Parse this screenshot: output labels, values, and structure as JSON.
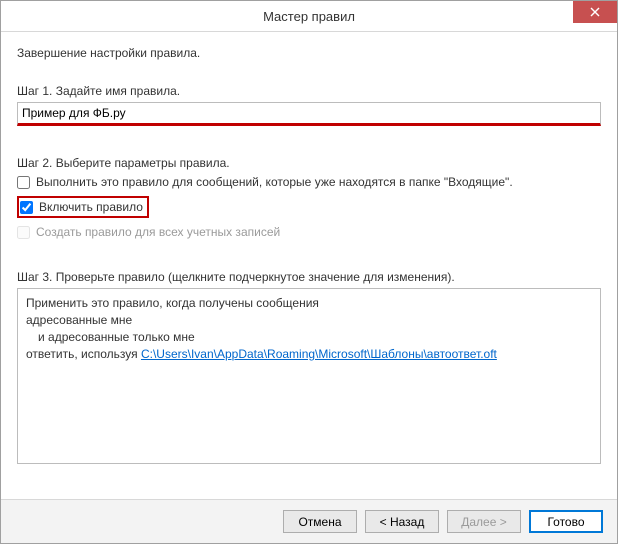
{
  "window": {
    "title": "Мастер правил"
  },
  "intro": "Завершение настройки правила.",
  "step1": {
    "label": "Шаг 1. Задайте имя правила.",
    "value": "Пример для ФБ.ру"
  },
  "step2": {
    "label": "Шаг 2. Выберите параметры правила.",
    "option_run_now": "Выполнить это правило для сообщений, которые уже находятся в папке \"Входящие\".",
    "option_enable": "Включить правило",
    "option_all_accounts": "Создать правило для всех учетных записей"
  },
  "step3": {
    "label": "Шаг 3. Проверьте правило (щелкните подчеркнутое значение для изменения).",
    "line1": "Применить это правило, когда получены сообщения",
    "line2": "адресованные мне",
    "line3": "и адресованные только мне",
    "line4_prefix": "ответить, используя ",
    "line4_link": "C:\\Users\\Ivan\\AppData\\Roaming\\Microsoft\\Шаблоны\\автоответ.oft"
  },
  "buttons": {
    "cancel": "Отмена",
    "back": "< Назад",
    "next": "Далее >",
    "finish": "Готово"
  }
}
